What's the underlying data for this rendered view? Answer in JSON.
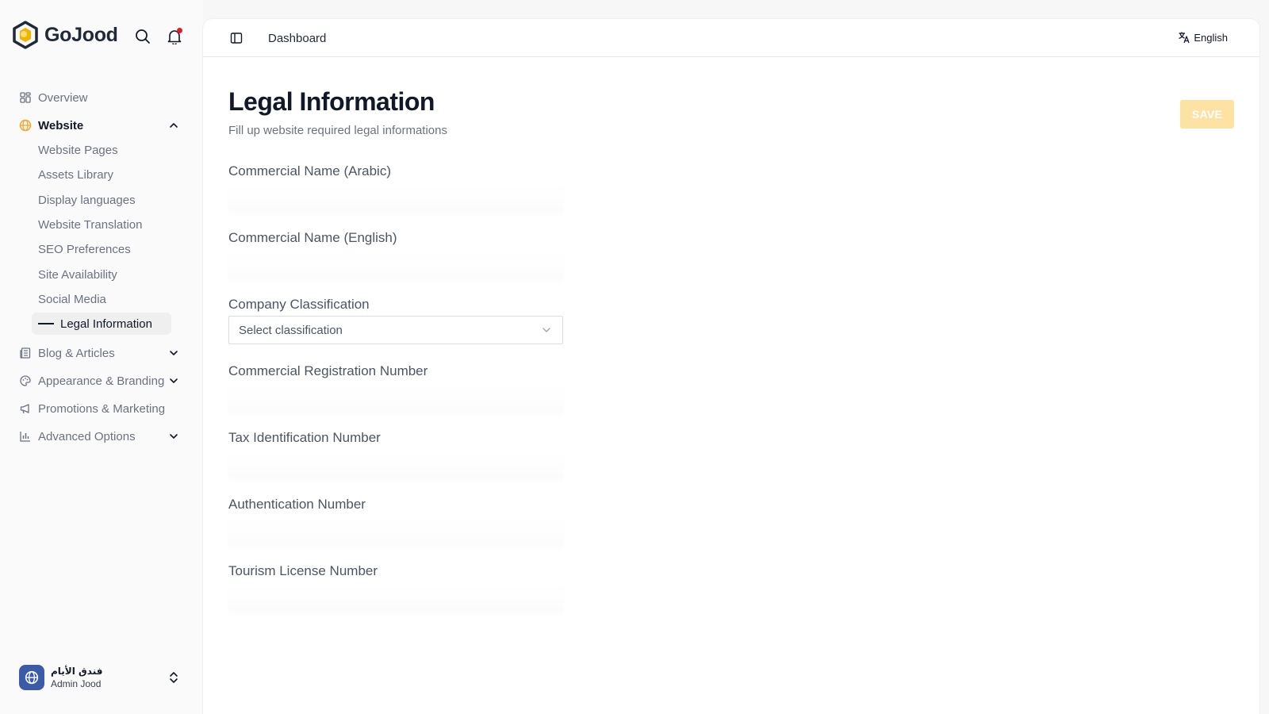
{
  "brand": {
    "name": "GoJood"
  },
  "sidebar": {
    "items": [
      {
        "label": "Overview"
      },
      {
        "label": "Website"
      },
      {
        "label": "Blog & Articles"
      },
      {
        "label": "Appearance & Branding"
      },
      {
        "label": "Promotions & Marketing"
      },
      {
        "label": "Advanced Options"
      }
    ],
    "website_sub": [
      {
        "label": "Website Pages"
      },
      {
        "label": "Assets Library"
      },
      {
        "label": "Display languages"
      },
      {
        "label": "Website Translation"
      },
      {
        "label": "SEO Preferences"
      },
      {
        "label": "Site Availability"
      },
      {
        "label": "Social Media"
      },
      {
        "label": "Legal Information"
      }
    ]
  },
  "account": {
    "name": "فندق الأيام",
    "role": "Admin Jood"
  },
  "topbar": {
    "breadcrumb": "Dashboard",
    "language": "English"
  },
  "page": {
    "title": "Legal Information",
    "subtitle": "Fill up website required legal informations",
    "save_label": "SAVE"
  },
  "form": {
    "commercial_name_ar": {
      "label": "Commercial Name (Arabic)",
      "value": ""
    },
    "commercial_name_en": {
      "label": "Commercial Name (English)",
      "value": ""
    },
    "company_classification": {
      "label": "Company Classification",
      "placeholder": "Select classification"
    },
    "commercial_registration": {
      "label": "Commercial Registration Number",
      "value": ""
    },
    "tax_id": {
      "label": "Tax Identification Number",
      "value": ""
    },
    "authentication_number": {
      "label": "Authentication Number",
      "value": ""
    },
    "tourism_license": {
      "label": "Tourism License Number",
      "value": ""
    }
  },
  "colors": {
    "accent": "#f5a623",
    "save_disabled": "#fde2a3",
    "notification": "#e11d2a",
    "avatar": "#3b5ba9"
  }
}
